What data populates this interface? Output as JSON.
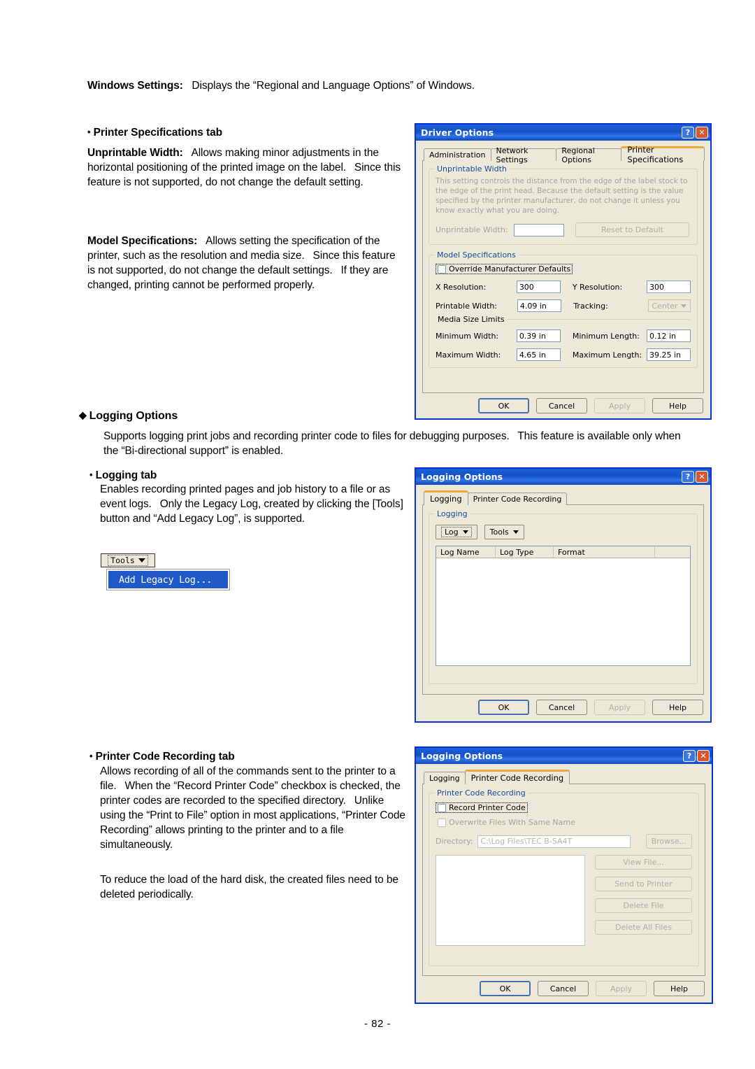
{
  "document": {
    "intro": {
      "label": "Windows Settings:",
      "text": "Displays the “Regional and Language Options” of Windows."
    },
    "printer_spec_section": {
      "bullet": "•",
      "heading": "Printer Specifications tab",
      "unprintable_label": "Unprintable Width:",
      "unprintable_text": "Allows making minor adjustments in the horizontal positioning of the printed image on the label.  Since this feature is not supported, do not change the default setting.",
      "model_label": "Model Specifications:",
      "model_text": "Allows setting the specification of the printer, such as the resolution and media size.  Since this feature is not supported, do not change the default settings.  If they are changed, printing cannot be performed properly."
    },
    "logging_section": {
      "diamond": "◆",
      "heading": "Logging Options",
      "description": "Supports logging print jobs and recording printer code to files for debugging purposes.  This feature is available only when the “Bi-directional support” is enabled.",
      "logging_tab": {
        "bullet": "•",
        "heading": "Logging tab",
        "text": "Enables recording printed pages and job history to a file or as event logs.  Only the Legacy Log, created by clicking the [Tools] button and “Add Legacy Log”, is supported."
      },
      "pcr_tab": {
        "bullet": "•",
        "heading": "Printer Code Recording tab",
        "text": "Allows recording of all of the commands sent to the printer to a file.  When the “Record Printer Code” checkbox is checked, the printer codes are recorded to the specified directory.  Unlike using the “Print to File” option in most applications, “Printer Code Recording” allows printing to the printer and to a file simultaneously.",
        "text2": "To reduce the load of the hard disk, the created files need to be deleted periodically."
      }
    },
    "page_number": "- 82 -"
  },
  "tools_menu": {
    "tools_label": "Tools",
    "menu_item": "Add Legacy Log..."
  },
  "driver_options_dialog": {
    "title": "Driver Options",
    "help_icon": "?",
    "close_icon": "✕",
    "tabs": [
      {
        "label": "Administration",
        "active": false
      },
      {
        "label": "Network Settings",
        "active": false
      },
      {
        "label": "Regional Options",
        "active": false
      },
      {
        "label": "Printer Specifications",
        "active": true
      }
    ],
    "unprintable_group": {
      "legend": "Unprintable Width",
      "help_text": "This setting controls the distance from the edge of the label stock to the edge of the print head.  Because the default setting is the value specified by the printer manufacturer, do not change it unless you know exactly what you are doing.",
      "field_label": "Unprintable Width:",
      "field_value": "",
      "reset_button": "Reset to Default"
    },
    "model_group": {
      "legend": "Model Specifications",
      "override_checkbox": "Override Manufacturer Defaults",
      "x_resolution_label": "X Resolution:",
      "x_resolution_value": "300",
      "y_resolution_label": "Y Resolution:",
      "y_resolution_value": "300",
      "printable_width_label": "Printable Width:",
      "printable_width_value": "4.09 in",
      "tracking_label": "Tracking:",
      "tracking_value": "Center",
      "media_legend": "Media Size Limits",
      "minimum_width_label": "Minimum Width:",
      "minimum_width_value": "0.39 in",
      "minimum_length_label": "Minimum Length:",
      "minimum_length_value": "0.12 in",
      "maximum_width_label": "Maximum Width:",
      "maximum_width_value": "4.65 in",
      "maximum_length_label": "Maximum Length:",
      "maximum_length_value": "39.25 in"
    },
    "buttons": {
      "ok": "OK",
      "cancel": "Cancel",
      "apply": "Apply",
      "help": "Help"
    }
  },
  "logging_dialog": {
    "title": "Logging Options",
    "help_icon": "?",
    "close_icon": "✕",
    "tabs": [
      {
        "label": "Logging",
        "active": true
      },
      {
        "label": "Printer Code Recording",
        "active": false
      }
    ],
    "group": {
      "legend": "Logging",
      "log_button": "Log",
      "tools_button": "Tools",
      "columns": [
        "Log Name",
        "Log Type",
        "Format"
      ],
      "rows": []
    },
    "buttons": {
      "ok": "OK",
      "cancel": "Cancel",
      "apply": "Apply",
      "help": "Help"
    }
  },
  "pcr_dialog": {
    "title": "Logging Options",
    "help_icon": "?",
    "close_icon": "✕",
    "tabs": [
      {
        "label": "Logging",
        "active": false
      },
      {
        "label": "Printer Code Recording",
        "active": true
      }
    ],
    "group": {
      "legend": "Printer Code Recording",
      "record_checkbox": "Record Printer Code",
      "overwrite_checkbox": "Overwrite Files With Same Name",
      "directory_label": "Directory:",
      "directory_value": "C:\\Log Files\\TEC B-SA4T",
      "browse_button": "Browse...",
      "view_file_button": "View File...",
      "send_to_printer_button": "Send to Printer",
      "delete_file_button": "Delete File",
      "delete_all_files_button": "Delete All Files"
    },
    "buttons": {
      "ok": "OK",
      "cancel": "Cancel",
      "apply": "Apply",
      "help": "Help"
    }
  },
  "colors": {
    "title_bar": "#1550c8",
    "dialog_face": "#ece9d8",
    "group_legend": "#134ba0",
    "active_tab_accent": "#f2a73b",
    "menu_highlight": "#2059c8",
    "dialog_border": "#0831d9"
  }
}
